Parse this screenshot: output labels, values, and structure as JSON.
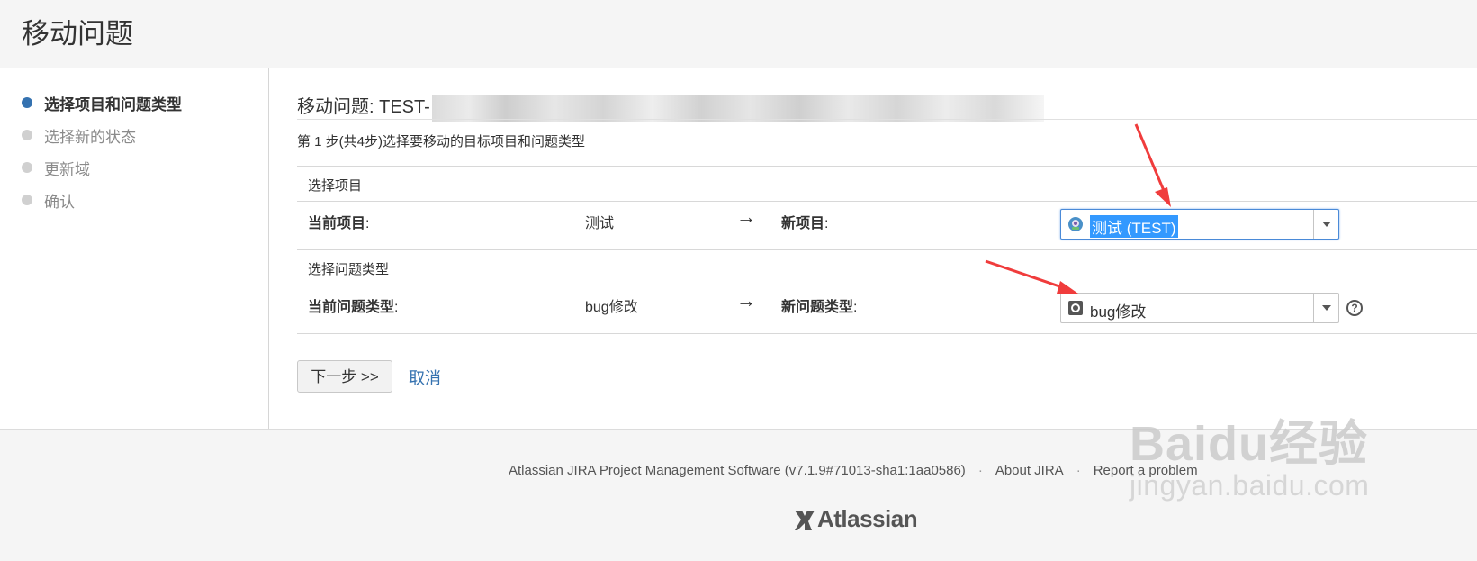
{
  "header": {
    "title": "移动问题"
  },
  "sidebar": {
    "steps": [
      {
        "label": "选择项目和问题类型",
        "active": true
      },
      {
        "label": "选择新的状态",
        "active": false
      },
      {
        "label": "更新域",
        "active": false
      },
      {
        "label": "确认",
        "active": false
      }
    ]
  },
  "main": {
    "title_prefix": "移动问题: TEST-",
    "step_desc": "第 1 步(共4步)选择要移动的目标项目和问题类型",
    "project_section": {
      "heading": "选择项目",
      "current_label": "当前项目",
      "current_value": "测试",
      "arrow": "→",
      "new_label": "新项目",
      "new_value": "测试 (TEST)"
    },
    "issuetype_section": {
      "heading": "选择问题类型",
      "current_label": "当前问题类型",
      "current_value": "bug修改",
      "arrow": "→",
      "new_label": "新问题类型",
      "new_value": "bug修改"
    },
    "colon": ":",
    "next_button": "下一步 >>",
    "cancel_link": "取消"
  },
  "footer": {
    "software": "Atlassian JIRA Project Management Software (v7.1.9#71013-sha1:1aa0586)",
    "about": "About JIRA",
    "report": "Report a problem",
    "separator": "·",
    "logo_text": "Atlassian"
  },
  "watermark": {
    "brand": "Baidu经验",
    "url": "jingyan.baidu.com"
  },
  "colors": {
    "accent": "#3572b0",
    "annotation_arrow": "#f03c3c"
  }
}
